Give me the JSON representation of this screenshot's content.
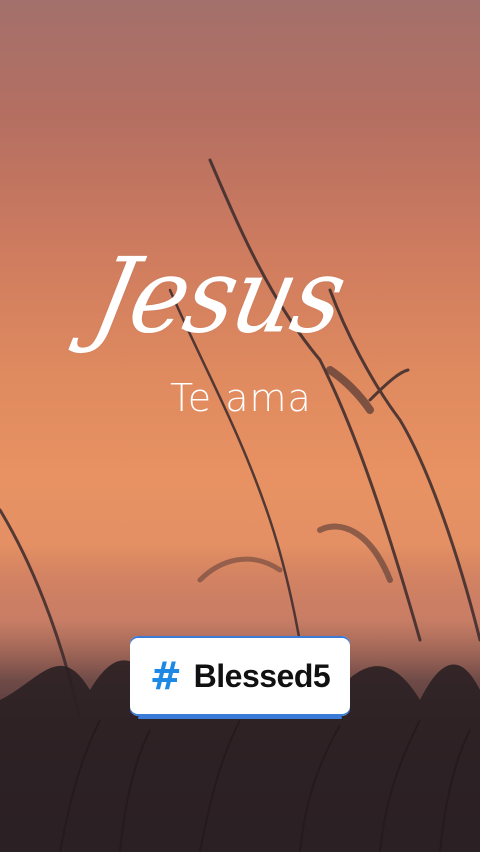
{
  "background": {
    "sky_top": "#a3706b",
    "sky_mid": "#df8a5f",
    "ground": "#2a2026"
  },
  "title": {
    "script": "Jesus",
    "subtitle": "Te ama"
  },
  "hashtag_sticker": {
    "icon": "hash-icon",
    "icon_color": "#1e88e5",
    "symbol": "#",
    "label": "Blessed5",
    "accent": "#3b7bd8"
  }
}
